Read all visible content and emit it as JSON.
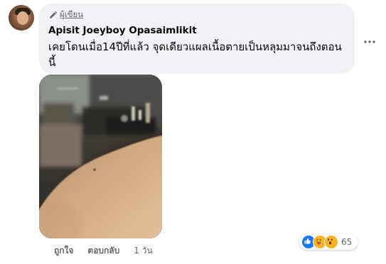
{
  "comment": {
    "author_badge": "ผู้เขียน",
    "author_name": "Apisit Joeyboy Opasaimlikit",
    "text": "เคยโดนเมื่อ14ปีที่แล้ว จุดเดียวแผลเนื้อตายเป็นหลุมมาจนถึงตอนนี้",
    "more_icon": "more-horizontal-icon",
    "avatar_icon": "profile-photo"
  },
  "actions": {
    "like_label": "ถูกใจ",
    "reply_label": "ตอบกลับ",
    "time": "1 วัน"
  },
  "reactions": {
    "icons": [
      "like-reaction-icon",
      "care-reaction-icon",
      "wow-reaction-icon"
    ],
    "count": "65"
  },
  "colors": {
    "bubble_bg": "#f0f2f5",
    "text_primary": "#050505",
    "text_secondary": "#65676b",
    "like_blue": "#1877f2",
    "reaction_yellow": "#f7b125"
  }
}
